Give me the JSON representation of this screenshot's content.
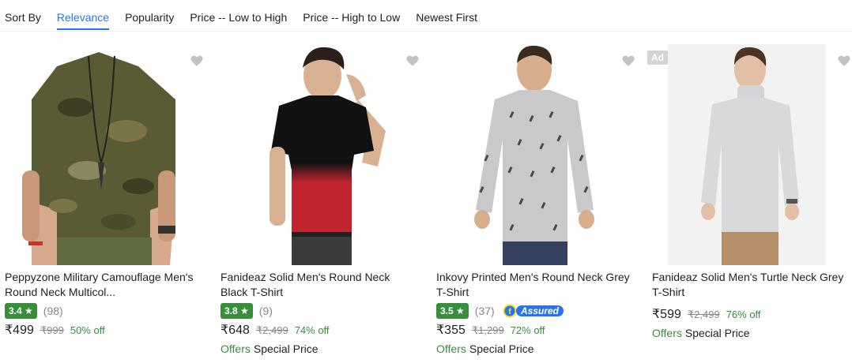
{
  "sort": {
    "label": "Sort By",
    "options": [
      "Relevance",
      "Popularity",
      "Price -- Low to High",
      "Price -- High to Low",
      "Newest First"
    ],
    "active": "Relevance"
  },
  "colors": {
    "accent": "#2874f0",
    "rating_green": "#388e3c",
    "muted": "#878787"
  },
  "products": [
    {
      "title_line1": "Peppyzone Military Camouflage Men's",
      "title_line2": "Round Neck Multicol...",
      "rating": "3.4 ★",
      "rating_count": "(98)",
      "price": "₹499",
      "mrp": "₹999",
      "discount": "50% off",
      "shirt_color": "camouflage-green",
      "wishlist_icon": "heart-icon"
    },
    {
      "title_line1": "Fanideaz Solid Men's Round Neck",
      "title_line2": "Black T-Shirt",
      "rating": "3.8 ★",
      "rating_count": "(9)",
      "price": "₹648",
      "mrp": "₹2,499",
      "discount": "74% off",
      "offers_keyword": "Offers",
      "offers_text": "Special Price",
      "shirt_color": "black-red-ombre",
      "wishlist_icon": "heart-icon"
    },
    {
      "title_line1": "Inkovy Printed Men's Round Neck Grey",
      "title_line2": "T-Shirt",
      "rating": "3.5 ★",
      "rating_count": "(37)",
      "assured_label": "Assured",
      "price": "₹355",
      "mrp": "₹1,299",
      "discount": "72% off",
      "offers_keyword": "Offers",
      "offers_text": "Special Price",
      "shirt_color": "grey-printed",
      "wishlist_icon": "heart-icon"
    },
    {
      "ad_label": "Ad",
      "title_line1": "Fanideaz Solid Men's Turtle Neck Grey",
      "title_line2": "T-Shirt",
      "price": "₹599",
      "mrp": "₹2,499",
      "discount": "76% off",
      "offers_keyword": "Offers",
      "offers_text": "Special Price",
      "shirt_color": "light-grey-turtleneck",
      "wishlist_icon": "heart-icon"
    }
  ]
}
